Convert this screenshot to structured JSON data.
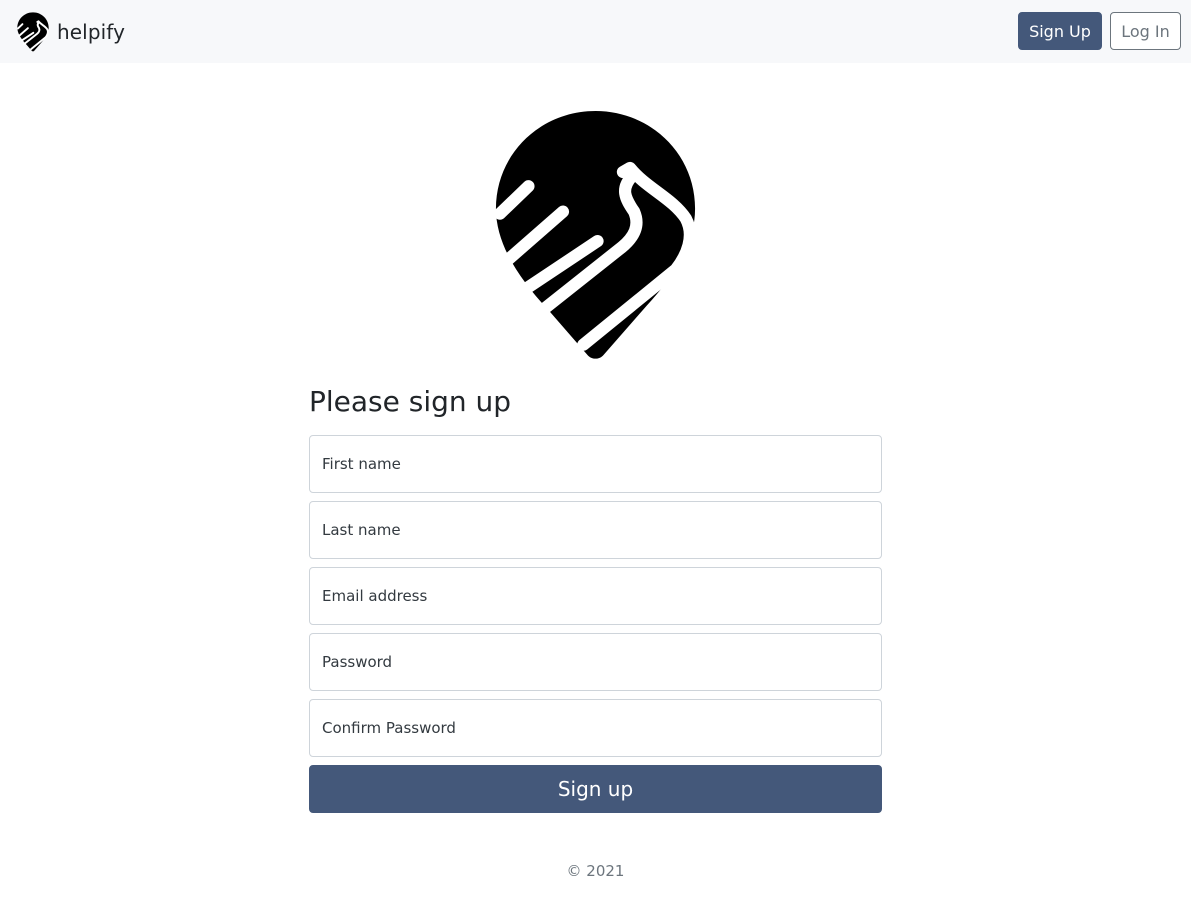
{
  "navbar": {
    "brand_name": "helpify",
    "brand_icon": "handshake-pin-icon",
    "signup_label": "Sign Up",
    "login_label": "Log In"
  },
  "main": {
    "hero_icon": "handshake-pin-icon",
    "heading": "Please sign up",
    "fields": {
      "first_name": {
        "placeholder": "First name",
        "value": ""
      },
      "last_name": {
        "placeholder": "Last name",
        "value": ""
      },
      "email": {
        "placeholder": "Email address",
        "value": ""
      },
      "password": {
        "placeholder": "Password",
        "value": ""
      },
      "confirm_password": {
        "placeholder": "Confirm Password",
        "value": ""
      }
    },
    "submit_label": "Sign up"
  },
  "footer": {
    "copyright": "© 2021"
  },
  "colors": {
    "primary": "#44587a",
    "navbar_bg": "#f7f8fa",
    "muted": "#6c757d"
  }
}
